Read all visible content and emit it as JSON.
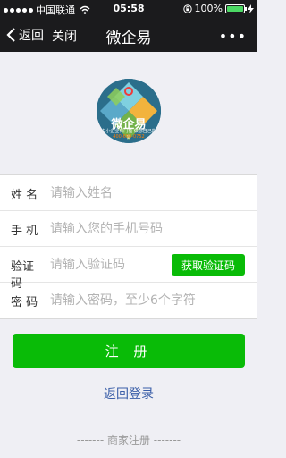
{
  "status_bar": {
    "carrier": "中国联通",
    "time": "05:58",
    "battery": "100%",
    "battery_level": 1.0,
    "icons": [
      "signal-dots-icon",
      "wifi-icon",
      "rotation-lock-icon",
      "battery-icon",
      "charging-bolt-icon"
    ]
  },
  "nav": {
    "back_label": "返回",
    "close_label": "关闭",
    "title": "微企易",
    "more_label": "•••"
  },
  "logo": {
    "brand": "微企易",
    "tagline": "让中小企业有门槛 做您自己的电商",
    "phone": "400-698-0752"
  },
  "form": {
    "fields": [
      {
        "label": "姓 名",
        "placeholder": "请输入姓名"
      },
      {
        "label": "手 机",
        "placeholder": "请输入您的手机号码"
      },
      {
        "label": "验证码",
        "placeholder": "请输入验证码"
      },
      {
        "label": "密 码",
        "placeholder": "请输入密码，至少6个字符"
      }
    ],
    "get_code_label": "获取验证码"
  },
  "submit_label": "注 册",
  "back_login_label": "返回登录",
  "merchant_label": "------- 商家注册 -------",
  "colors": {
    "primary_green": "#09bb07",
    "link_blue": "#3a5ea8",
    "bar_dark": "#1b1b1d"
  }
}
